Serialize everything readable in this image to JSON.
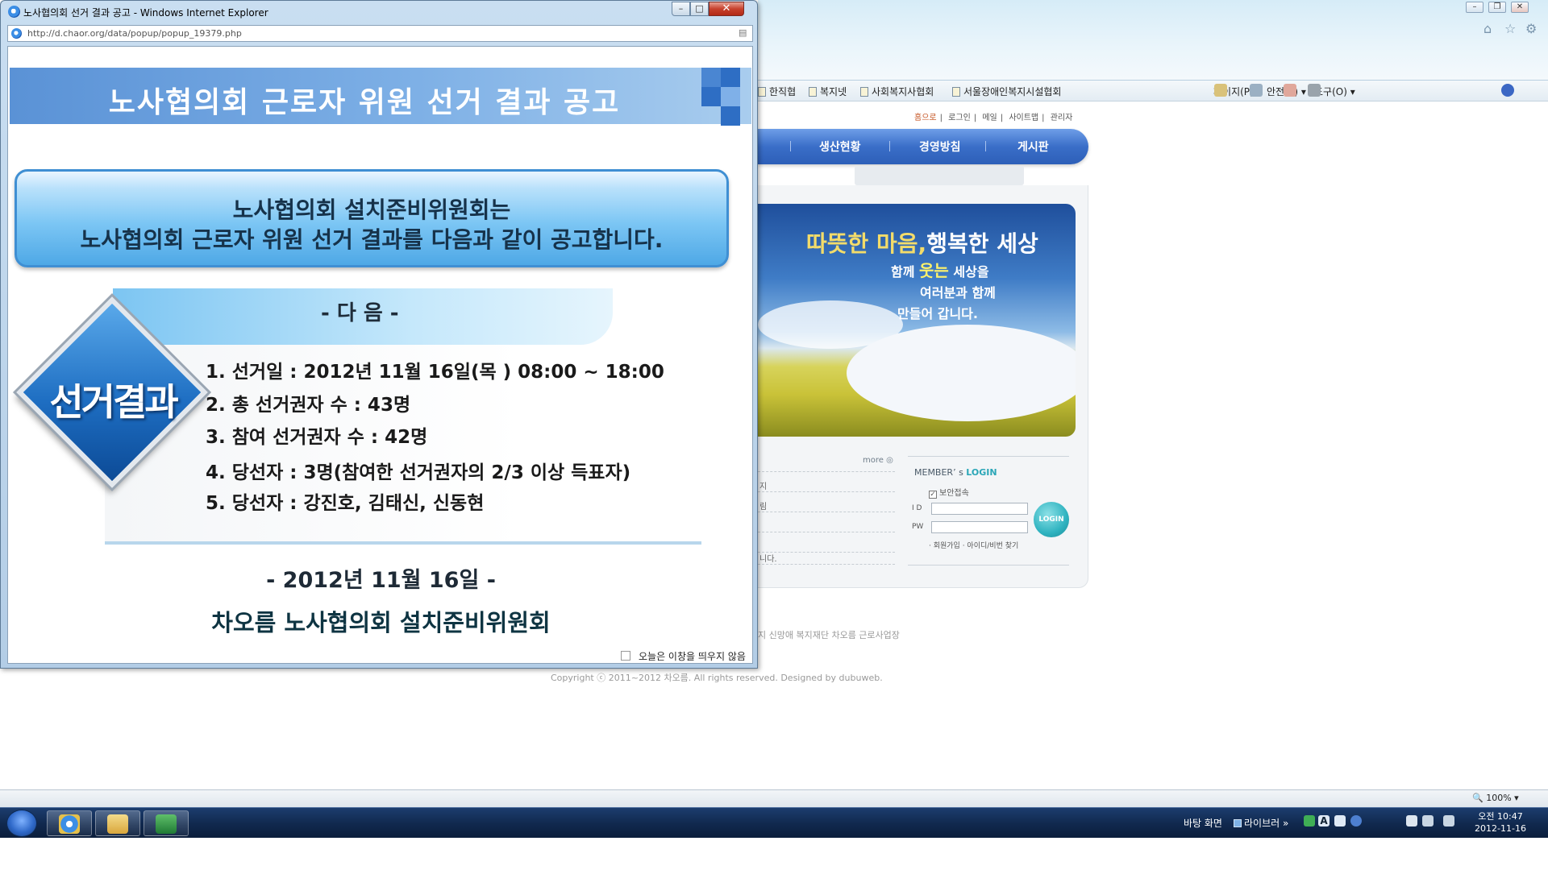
{
  "popup": {
    "window_title": "노사협의회 선거 결과 공고 - Windows Internet Explorer",
    "address": "http://d.chaor.org/data/popup/popup_19379.php",
    "address_domain": "chaor.org",
    "banner_title": "노사협의회 근로자 위원 선거 결과 공고",
    "notice_line1": "노사협의회 설치준비위원회는",
    "notice_line2": "노사협의회 근로자 위원 선거 결과를 다음과 같이 공고합니다.",
    "next_label": "- 다 음 -",
    "badge_text": "선거결과",
    "items": [
      "1. 선거일 : 2012년 11월 16일(목 ) 08:00 ~ 18:00",
      "2. 총 선거권자 수 : 43명",
      "3. 참여 선거권자 수 : 42명",
      "4. 당선자 : 3명(참여한 선거권자의 2/3 이상 득표자)",
      "5. 당선자 : 강진호, 김태신, 신동현"
    ],
    "date": "- 2012년 11월 16일 -",
    "org": "차오름 노사협의회 설치준비위원회",
    "no_show_label": "오늘은 이창을 띄우지 않음"
  },
  "browser": {
    "favorites": [
      "한직협",
      "복지넷",
      "사회복지사협회",
      "서울장애인복지시설협회"
    ],
    "commands": [
      "페이지(P)",
      "안전(S)",
      "도구(O)"
    ],
    "zoom": "100%"
  },
  "site": {
    "top_links": [
      "홈으로",
      "로그인",
      "메일",
      "사이트맵",
      "관리자"
    ],
    "nav": [
      "생산현황",
      "경영방침",
      "게시판"
    ],
    "hero_title_a": "따뜻한 마음,",
    "hero_title_b": "행복한 세상",
    "hero_sub_1a": "함께 ",
    "hero_sub_1b": "웃는",
    "hero_sub_1c": " 세상을",
    "hero_sub_2": "여러분과 함께",
    "hero_sub_3": "만들어 갑니다.",
    "more": "more",
    "news_fragments": [
      "지",
      "림",
      "니다."
    ],
    "login_title_a": "MEMBER’ s ",
    "login_title_b": "LOGIN",
    "secure_label": "보안접속",
    "id_label": "I D",
    "pw_label": "PW",
    "login_button": "LOGIN",
    "login_links": "· 회원가입   · 아이디/비번 찾기",
    "footer_addr": "지 신망애 복지재단 차오름 근로사업장",
    "copyright": "Copyright ⓒ 2011~2012 차오름. All rights reserved. Designed by dubuweb."
  },
  "taskbar": {
    "desktop_label": "바탕 화면",
    "live_label": "라이브러",
    "clock_period_time": "오전 10:47",
    "clock_date": "2012-11-16"
  },
  "colors": {
    "banner": "#5a92d6",
    "notice_border": "#3f8fd3",
    "badge": "#1e6ec2",
    "taskbar": "#10284d"
  }
}
